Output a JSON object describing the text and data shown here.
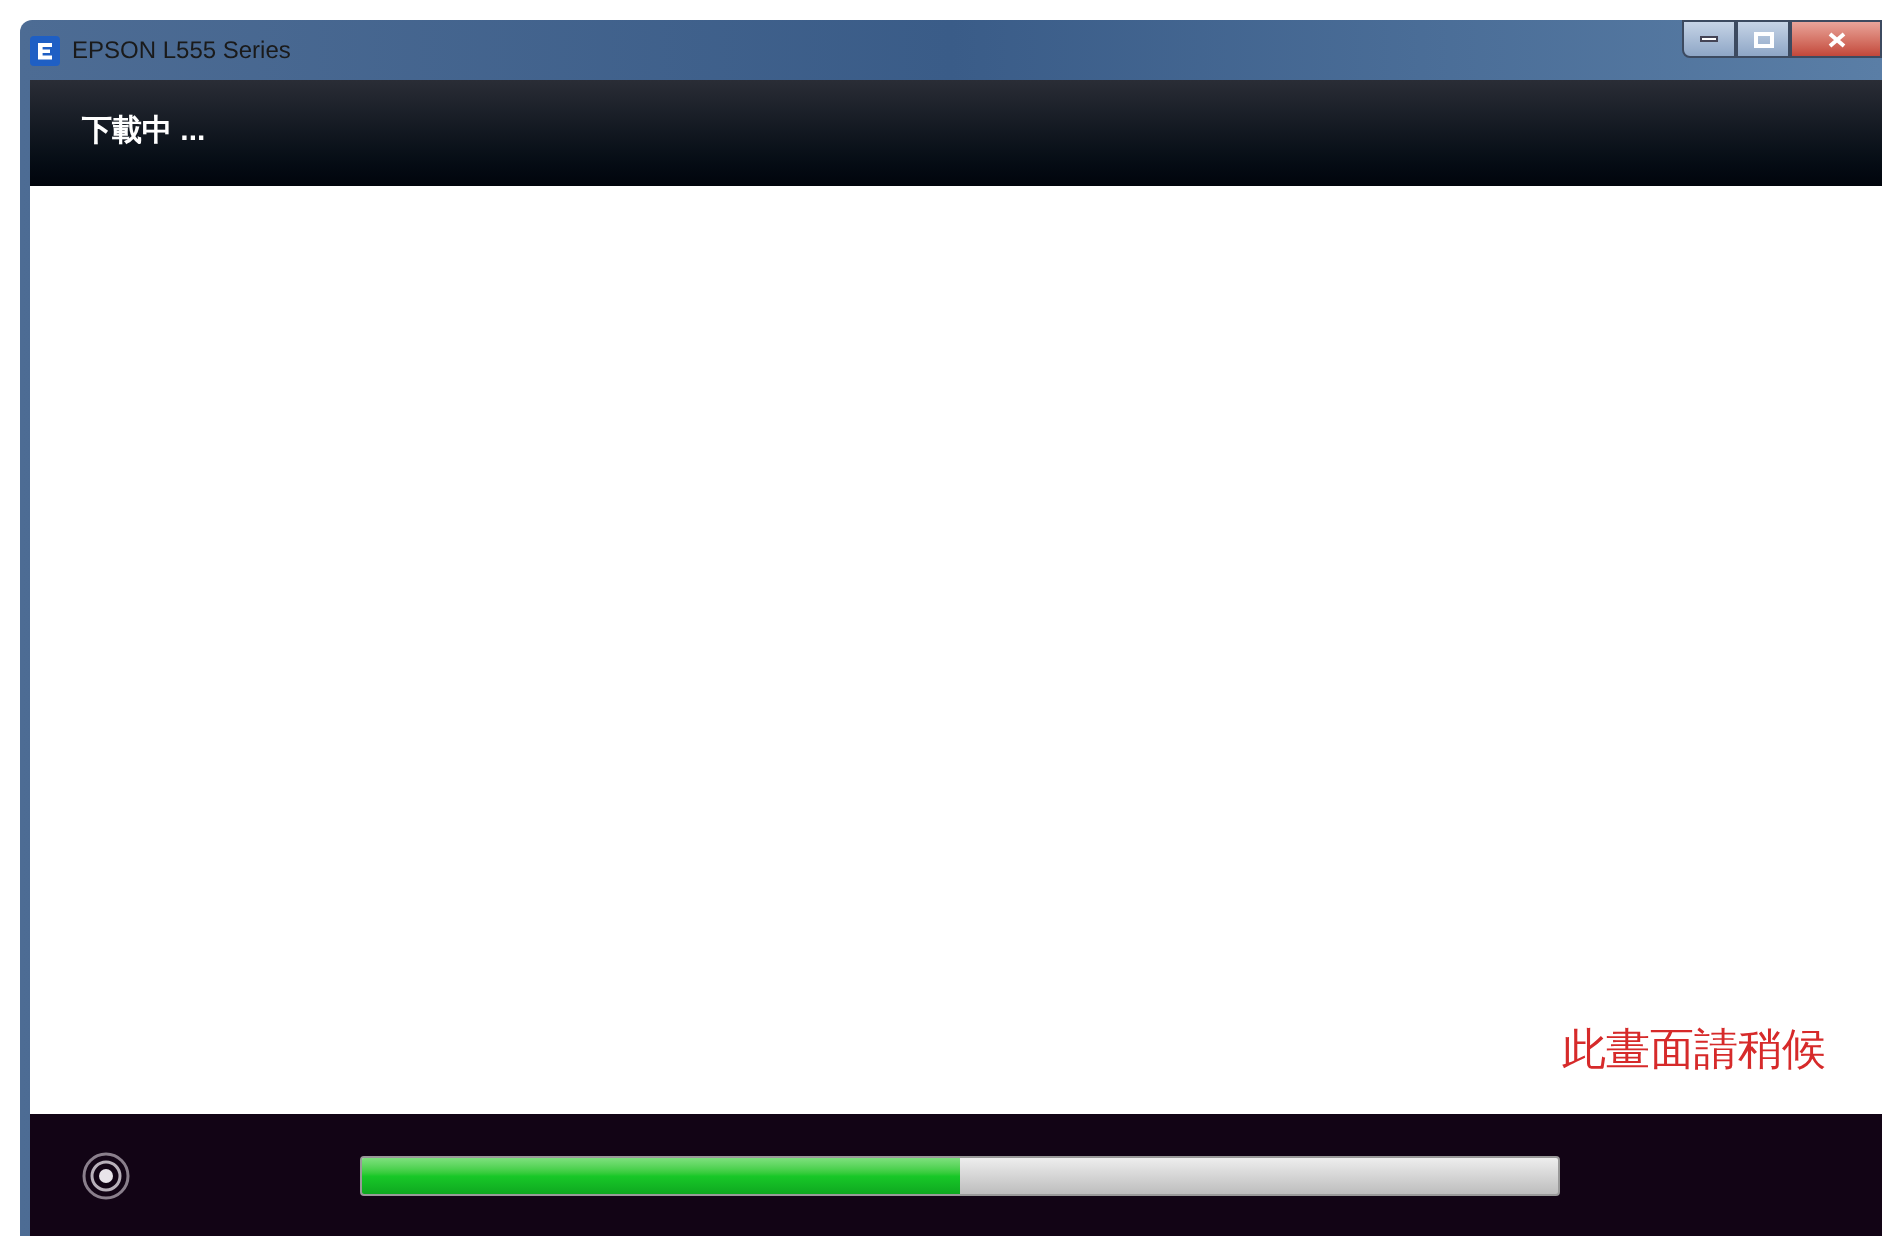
{
  "window": {
    "title": "EPSON L555 Series"
  },
  "header": {
    "title": "下載中 ..."
  },
  "content": {
    "notice": "此畫面請稍候"
  },
  "footer": {
    "progress": {
      "level": 0.5
    }
  }
}
